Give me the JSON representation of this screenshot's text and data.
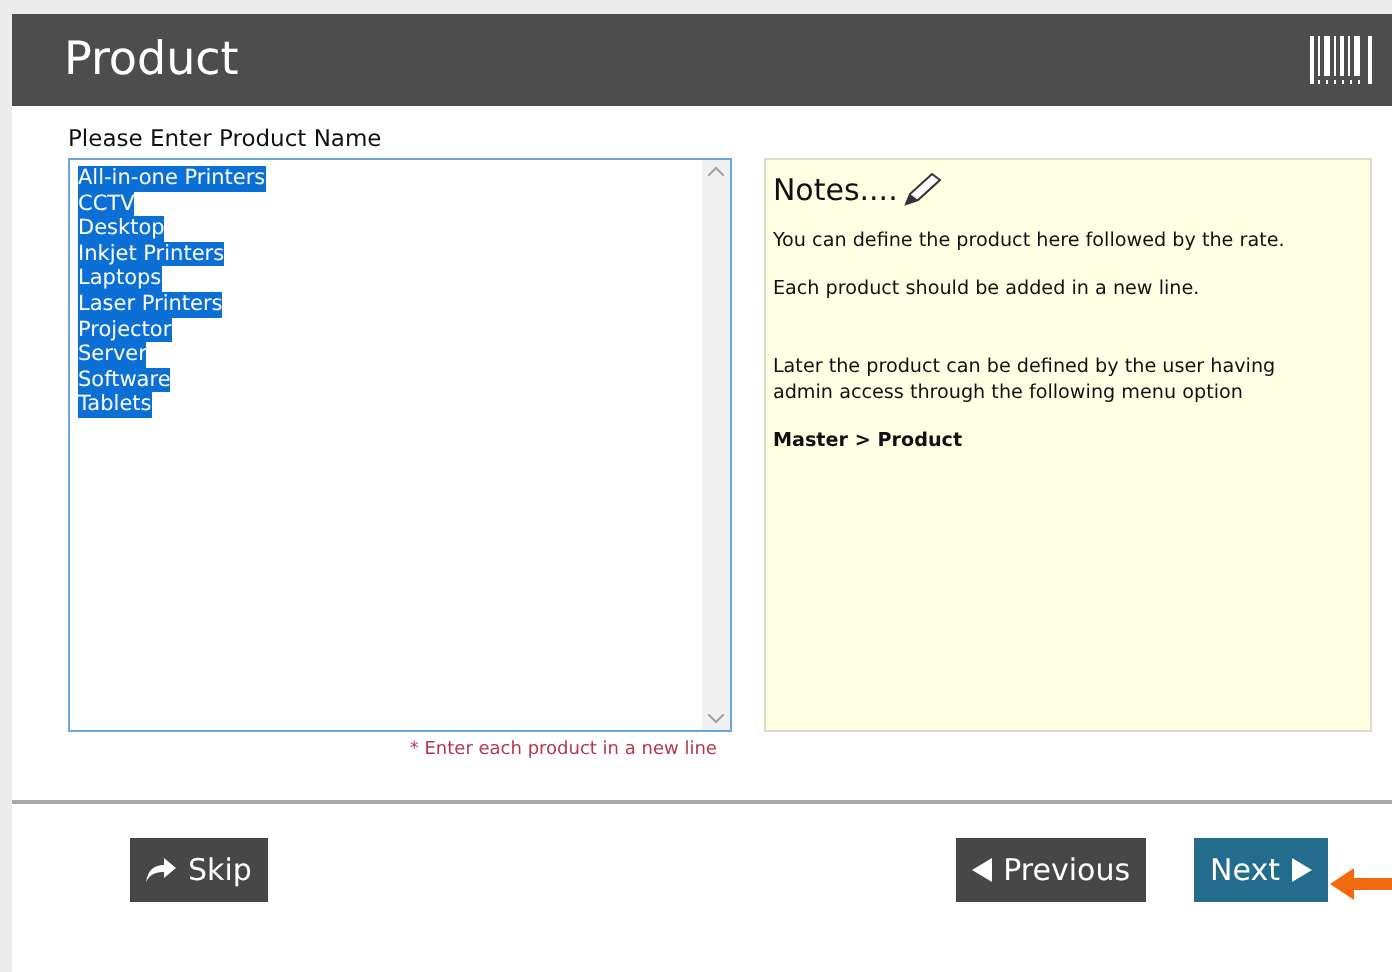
{
  "header": {
    "title": "Product"
  },
  "product_field": {
    "label": "Please Enter Product Name",
    "hint": "* Enter each product in a new line",
    "lines": [
      {
        "text": "All-in-one Printers",
        "selected": true
      },
      {
        "text": "CCTV",
        "selected": true
      },
      {
        "text": "Desktop",
        "selected": true
      },
      {
        "text": "Inkjet Printers",
        "selected": true
      },
      {
        "text": "Laptops",
        "selected": true
      },
      {
        "text": "Laser Printers",
        "selected": true
      },
      {
        "text": "Projector",
        "selected": true
      },
      {
        "text": "Server",
        "selected": true
      },
      {
        "text": "Software",
        "selected": true
      },
      {
        "text": "Tablets",
        "selected": true
      }
    ]
  },
  "notes": {
    "title": "Notes....",
    "paragraphs": [
      {
        "text": "You can define the product here followed by the rate.",
        "bold": false
      },
      {
        "text": "Each product should be added in a new line.",
        "bold": false
      },
      {
        "text": "Later the product can be defined by the user having admin access through the following menu option",
        "bold": false
      },
      {
        "text": "Master > Product",
        "bold": true
      }
    ]
  },
  "buttons": [
    {
      "label": "Skip",
      "kind": "skip"
    },
    {
      "label": "Previous",
      "kind": "previous"
    },
    {
      "label": "Next",
      "kind": "next"
    }
  ]
}
